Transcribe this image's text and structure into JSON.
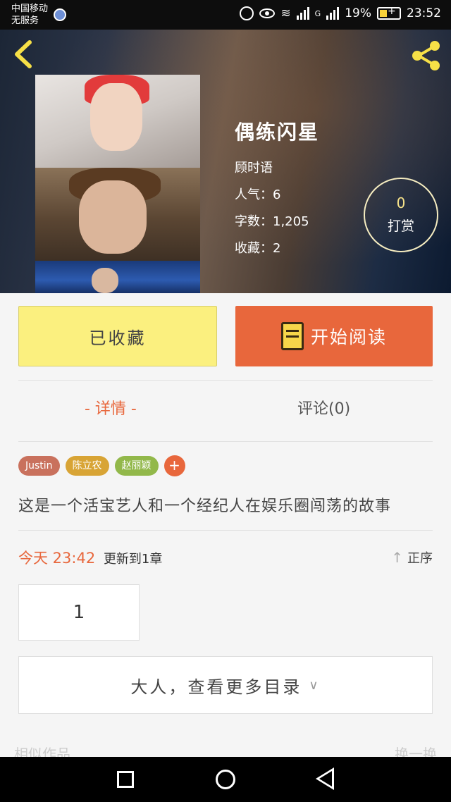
{
  "status_bar": {
    "carrier_line1": "中国移动",
    "carrier_line2": "无服务",
    "signal_type": "G",
    "battery": "19%",
    "time": "23:52"
  },
  "header": {
    "back_icon": "back-chevron-icon",
    "share_icon": "share-icon"
  },
  "book": {
    "title": "偶练闪星",
    "author": "顾时语",
    "popularity": "人气：6",
    "word_count": "字数：1,205",
    "favorites": "收藏：2",
    "tip_count": "0",
    "tip_label": "打赏"
  },
  "actions": {
    "collected_label": "已收藏",
    "read_label": "开始阅读",
    "read_icon": "book-icon"
  },
  "tabs": {
    "detail": "- 详情 -",
    "comments": "评论(0)"
  },
  "tags": [
    {
      "label": "Justin",
      "color": "#c9715d"
    },
    {
      "label": "陈立农",
      "color": "#d8a435"
    },
    {
      "label": "赵丽颖",
      "color": "#92b84a"
    }
  ],
  "tag_add_label": "+",
  "summary": "这是一个活宝艺人和一个经纪人在娱乐圈闯荡的故事",
  "update": {
    "date": "今天 23:42",
    "text": "更新到1章",
    "sort_label": "正序"
  },
  "chapters": [
    "1"
  ],
  "more_catalog": "大人，查看更多目录",
  "similar": {
    "title": "相似作品",
    "refresh": "换一换"
  },
  "colors": {
    "accent": "#e8673c",
    "collect_bg": "#fbf07f"
  }
}
